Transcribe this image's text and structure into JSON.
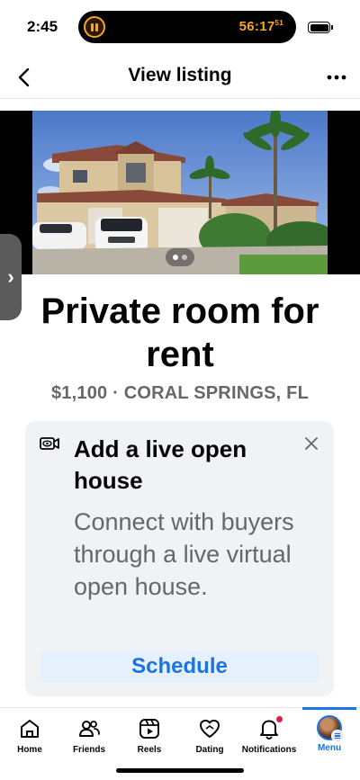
{
  "status_bar": {
    "time": "2:45",
    "timer_main": "56:17",
    "timer_sub": "51"
  },
  "header": {
    "title": "View listing",
    "back_icon": "chevron-left-icon",
    "more_icon": "more-horizontal-icon"
  },
  "listing": {
    "title": "Private room for rent",
    "subtitle": "$1,100 · CORAL SPRINGS, FL",
    "photo_count": 2,
    "photo_index": 1
  },
  "open_house_card": {
    "icon": "video-eye-icon",
    "title": "Add a live open house",
    "body": "Connect with buyers through a live virtual open house.",
    "button_label": "Schedule"
  },
  "tab_bar": {
    "tabs": [
      {
        "label": "Home",
        "icon": "home-icon"
      },
      {
        "label": "Friends",
        "icon": "friends-icon"
      },
      {
        "label": "Reels",
        "icon": "reels-icon"
      },
      {
        "label": "Dating",
        "icon": "dating-icon"
      },
      {
        "label": "Notifications",
        "icon": "bell-icon"
      },
      {
        "label": "Menu",
        "icon": "avatar-menu-icon"
      }
    ],
    "active": "Menu"
  },
  "colors": {
    "accent": "#1b74e4",
    "secondary_text": "#65676b",
    "card_bg": "#f0f2f5",
    "badge": "#e41e3f",
    "timer": "#f5a623"
  }
}
